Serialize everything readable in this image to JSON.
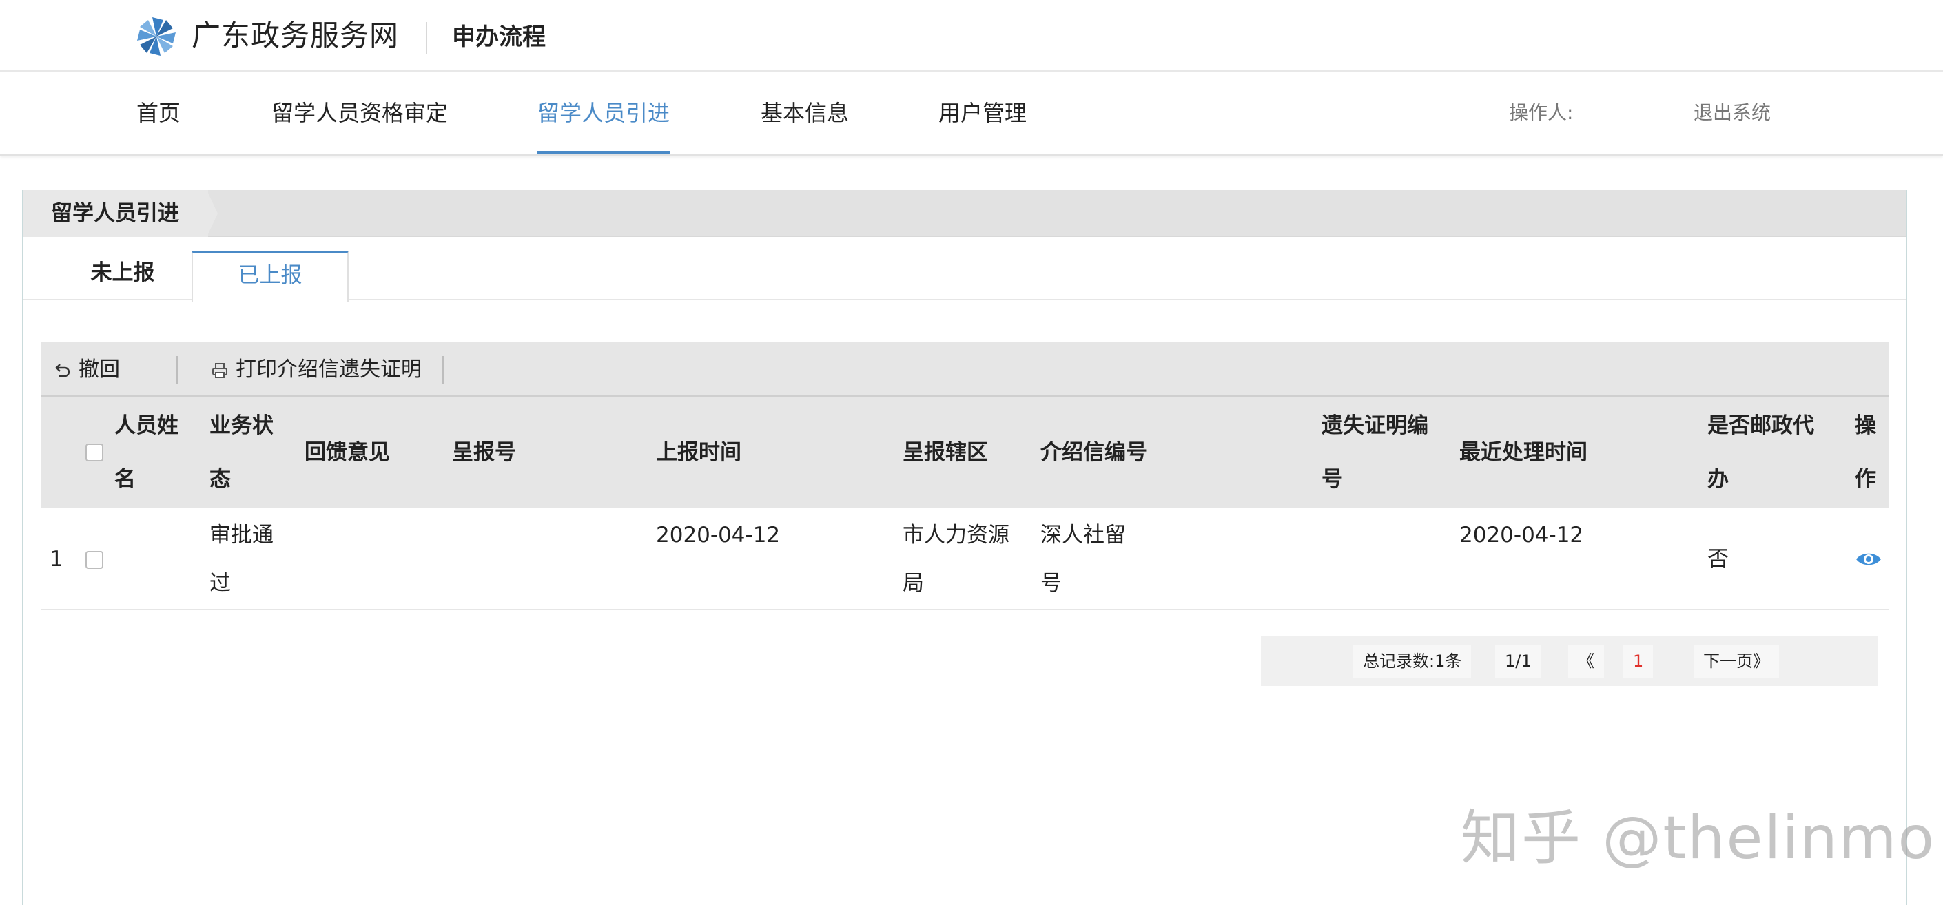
{
  "header": {
    "brand": "广东政务服务网",
    "subtitle": "申办流程",
    "logo_icon": "pinwheel-logo-icon"
  },
  "nav": {
    "items": [
      {
        "label": "首页"
      },
      {
        "label": "留学人员资格审定"
      },
      {
        "label": "留学人员引进",
        "active": true
      },
      {
        "label": "基本信息"
      },
      {
        "label": "用户管理"
      }
    ],
    "operator_label": "操作人:",
    "logout_label": "退出系统"
  },
  "panel": {
    "title": "留学人员引进",
    "tabs": [
      {
        "label": "未上报"
      },
      {
        "label": "已上报",
        "active": true
      }
    ]
  },
  "toolbar": {
    "withdraw_label": "撤回",
    "withdraw_icon": "undo-icon",
    "print_label": "打印介绍信遗失证明",
    "print_icon": "printer-icon"
  },
  "table": {
    "columns": [
      {
        "l1": "",
        "l2": ""
      },
      {
        "l1": "人员姓",
        "l2": "名"
      },
      {
        "l1": "业务状",
        "l2": "态"
      },
      {
        "l1": "回馈意见",
        "l2": ""
      },
      {
        "l1": "呈报号",
        "l2": ""
      },
      {
        "l1": "上报时间",
        "l2": ""
      },
      {
        "l1": "呈报辖区",
        "l2": ""
      },
      {
        "l1": "介绍信编号",
        "l2": ""
      },
      {
        "l1": "遗失证明编",
        "l2": "号"
      },
      {
        "l1": "最近处理时间",
        "l2": ""
      },
      {
        "l1": "是否邮政代",
        "l2": "办"
      },
      {
        "l1": "操",
        "l2": "作"
      }
    ],
    "rows": [
      {
        "index": "1",
        "name": "",
        "status_l1": "审批通",
        "status_l2": "过",
        "feedback": "",
        "report_no": "",
        "report_time": "2020-04-12",
        "district_l1": "市人力资源",
        "district_l2": "局",
        "letter_no_l1": "深人社留",
        "letter_no_l2": "号",
        "lost_cert_no": "",
        "last_time": "2020-04-12",
        "postal": "否",
        "action_icon": "eye-icon"
      }
    ]
  },
  "pagination": {
    "total": "总记录数:1条",
    "pages": "1/1",
    "prev": "《",
    "current": "1",
    "next": "下一页》"
  },
  "colors": {
    "accent": "#4a8ac7",
    "header_gray": "#e6e6e6",
    "page_current": "#e0312b",
    "logo_blue": "#3a7fc4"
  },
  "watermark": "知乎 @thelinmo"
}
